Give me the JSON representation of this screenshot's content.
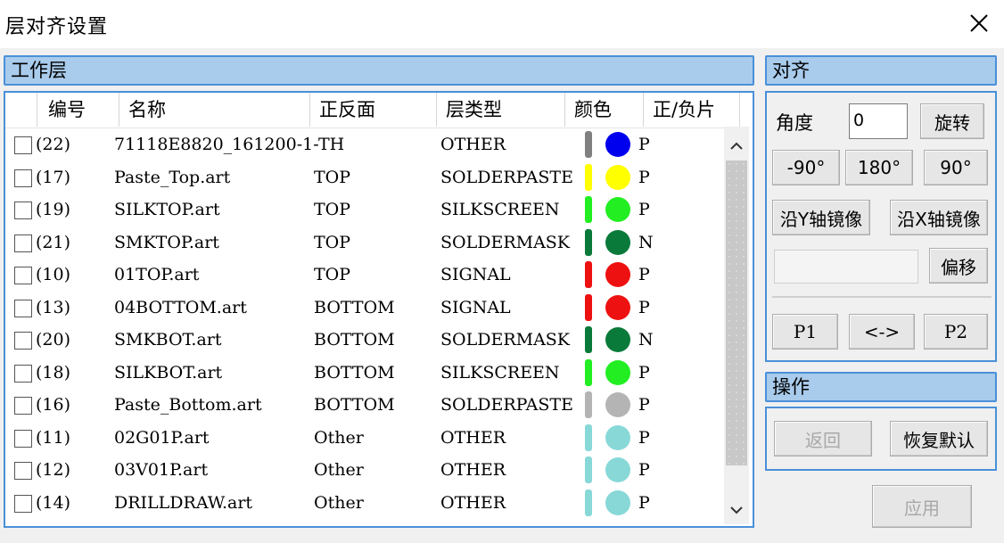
{
  "window": {
    "title": "层对齐设置"
  },
  "sections": {
    "work_layer": "工作层",
    "align": "对齐",
    "operation": "操作"
  },
  "table": {
    "columns": [
      "编号",
      "名称",
      "正反面",
      "层类型",
      "颜色",
      "正/负片"
    ],
    "rows": [
      {
        "id": "(22)",
        "name": "71118E8820_161200-1-TH",
        "side": "",
        "type": "OTHER",
        "bar_color": "#808080",
        "dot_color": "#0000ee",
        "polarity": "P"
      },
      {
        "id": "(17)",
        "name": "Paste_Top.art",
        "side": "TOP",
        "type": "SOLDERPASTE",
        "bar_color": "#ffff00",
        "dot_color": "#ffff00",
        "polarity": "P"
      },
      {
        "id": "(19)",
        "name": "SILKTOP.art",
        "side": "TOP",
        "type": "SILKSCREEN",
        "bar_color": "#22ee22",
        "dot_color": "#22ee22",
        "polarity": "P"
      },
      {
        "id": "(21)",
        "name": "SMKTOP.art",
        "side": "TOP",
        "type": "SOLDERMASK",
        "bar_color": "#0a7a3a",
        "dot_color": "#0a7a3a",
        "polarity": "N"
      },
      {
        "id": "(10)",
        "name": "01TOP.art",
        "side": "TOP",
        "type": "SIGNAL",
        "bar_color": "#ee1111",
        "dot_color": "#ee1111",
        "polarity": "P"
      },
      {
        "id": "(13)",
        "name": "04BOTTOM.art",
        "side": "BOTTOM",
        "type": "SIGNAL",
        "bar_color": "#ee1111",
        "dot_color": "#ee1111",
        "polarity": "P"
      },
      {
        "id": "(20)",
        "name": "SMKBOT.art",
        "side": "BOTTOM",
        "type": "SOLDERMASK",
        "bar_color": "#0a7a3a",
        "dot_color": "#0a7a3a",
        "polarity": "N"
      },
      {
        "id": "(18)",
        "name": "SILKBOT.art",
        "side": "BOTTOM",
        "type": "SILKSCREEN",
        "bar_color": "#22ee22",
        "dot_color": "#22ee22",
        "polarity": "P"
      },
      {
        "id": "(16)",
        "name": "Paste_Bottom.art",
        "side": "BOTTOM",
        "type": "SOLDERPASTE",
        "bar_color": "#b4b4b4",
        "dot_color": "#b4b4b4",
        "polarity": "P"
      },
      {
        "id": "(11)",
        "name": "02G01P.art",
        "side": "Other",
        "type": "OTHER",
        "bar_color": "#88d8d8",
        "dot_color": "#88d8d8",
        "polarity": "P"
      },
      {
        "id": "(12)",
        "name": "03V01P.art",
        "side": "Other",
        "type": "OTHER",
        "bar_color": "#88d8d8",
        "dot_color": "#88d8d8",
        "polarity": "P"
      },
      {
        "id": "(14)",
        "name": "DRILLDRAW.art",
        "side": "Other",
        "type": "OTHER",
        "bar_color": "#88d8d8",
        "dot_color": "#88d8d8",
        "polarity": "P"
      }
    ]
  },
  "align": {
    "angle_label": "角度",
    "angle_value": "0",
    "rotate": "旋转",
    "neg90": "-90°",
    "r180": "180°",
    "r90": "90°",
    "mirror_y": "沿Y轴镜像",
    "mirror_x": "沿X轴镜像",
    "offset_value": "",
    "offset": "偏移",
    "p1": "P1",
    "swap": "<->",
    "p2": "P2"
  },
  "operation": {
    "back": "返回",
    "restore": "恢复默认"
  },
  "apply": "应用",
  "colors": {
    "accent": "#4a90d9",
    "header_fill": "#a9cbec"
  }
}
